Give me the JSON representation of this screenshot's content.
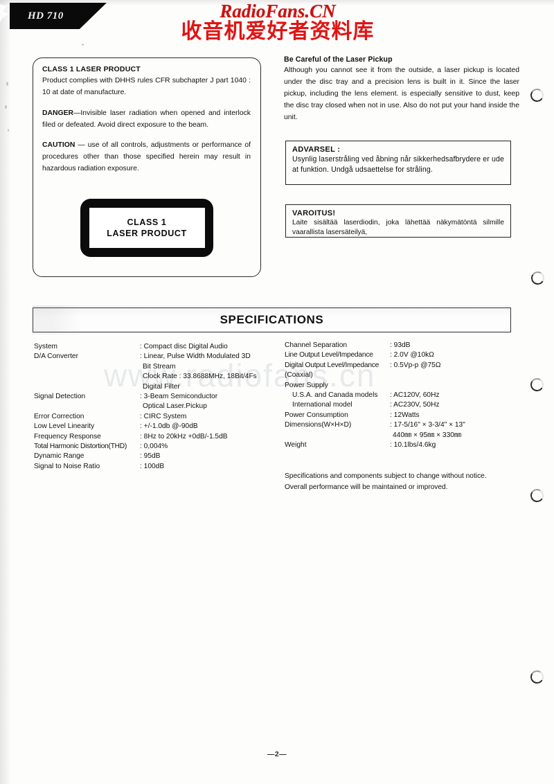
{
  "page": {
    "model_banner": "HD 710",
    "page_number": "—2—",
    "url_watermark": "www.radiofans.cn"
  },
  "watermark": {
    "latin": "RadioFans.CN",
    "cjk": "收音机爱好者资料库"
  },
  "laser_notice": {
    "heading": "CLASS 1 LASER PRODUCT",
    "intro": "Product complies with DHHS rules CFR subchapter J part 1040 : 10 at date of manufacture.",
    "danger_lead": "DANGER",
    "danger_text": "—Invisible laser radiation when opened and interlock filed or defeated. Avoid direct exposure to the beam.",
    "caution_lead": "CAUTION",
    "caution_text": " — use of all controls, adjustments or performance of procedures other than those specified herein may result in hazardous radiation exposure.",
    "plate_line1": "CLASS 1",
    "plate_line2": "LASER PRODUCT"
  },
  "pickup_care": {
    "heading": "Be Careful of the Laser Pickup",
    "body": "Although you cannot see it from the outside, a laser pickup is located under the disc tray and a precision lens is built in it. Since the laser pickup, including the lens element. is especially sensitive to dust, keep the disc tray closed when not in use. Also do not put your hand inside the unit."
  },
  "advarsel": {
    "title": "ADVARSEL :",
    "body": "Usynlig laserstråling ved åbning når sikkerhedsafbrydere er ude at funktion. Undgå udsaettelse for stråling."
  },
  "varoitus": {
    "title": "VAROITUS!",
    "body": "Laite sisältää laserdiodin, joka lähettää näkymätöntä silmille vaarallista lasersäteilyä,"
  },
  "specifications": {
    "title": "SPECIFICATIONS",
    "left": [
      {
        "label": "System",
        "value": ": Compact disc Digital Audio"
      },
      {
        "label": "D/A Converter",
        "value": ": Linear, Pulse Width Modulated 3D"
      },
      {
        "cont": "Bit Stream"
      },
      {
        "cont": "Clock Rate : 33.8688MHz, 18Bit/4Fs"
      },
      {
        "cont": "Digital Filter"
      },
      {
        "label": "Signal Detection",
        "value": ": 3-Beam Semiconductor"
      },
      {
        "cont": "Optical Laser.Pickup"
      },
      {
        "label": "Error Correction",
        "value": ": CIRC System"
      },
      {
        "label": "Low Level Linearity",
        "value": ": +/-1.0db @-90dB"
      },
      {
        "label": "Frequency Response",
        "value": ": 8Hz to 20kHz +0dB/-1.5dB"
      },
      {
        "label": "Total Harmonic Distortion(THD)",
        "value": ": 0,004%",
        "tight": true
      },
      {
        "label": "Dynamic Range",
        "value": ": 95dB"
      },
      {
        "label": "Signal to Noise Ratio",
        "value": ": 100dB"
      }
    ],
    "right": [
      {
        "label": "Channel Separation",
        "value": ": 93dB"
      },
      {
        "label": "Line Output Level/Impedance",
        "value": ": 2.0V @10kΩ",
        "tight": true
      },
      {
        "label": "Digital Output Level/Impedance",
        "value": ": 0.5Vp-p @75Ω",
        "tight": true
      },
      {
        "plain": "(Coaxial)"
      },
      {
        "plain": "Power Supply"
      },
      {
        "label": "U.S.A. and Canada models",
        "value": ": AC120V, 60Hz",
        "sub": true
      },
      {
        "label": "International model",
        "value": ": AC230V, 50Hz",
        "sub": true
      },
      {
        "label": "Power Consumption",
        "value": ": 12Watts"
      },
      {
        "label": "Dimensions(W×H×D)",
        "value": ": 17-5/16\" × 3-3/4\" × 13\""
      },
      {
        "cont": "440㎜ × 95㎜ × 330㎜"
      },
      {
        "label": "Weight",
        "value": ": 10.1lbs/4.6kg"
      }
    ],
    "note_line1": "Specifications and components subject to change without notice.",
    "note_line2": "Overall performance will be maintained or improved."
  }
}
